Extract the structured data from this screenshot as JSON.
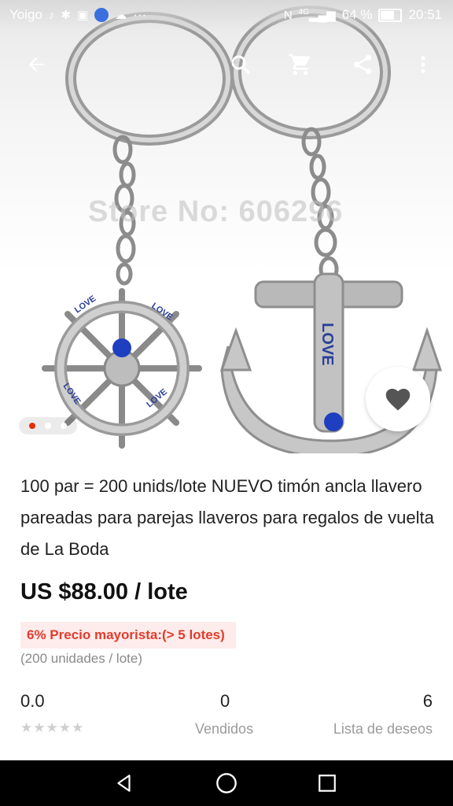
{
  "status_bar": {
    "carrier": "Yoigo",
    "battery": "64 %",
    "time": "20:51",
    "overflow": "···",
    "signal": "4G"
  },
  "icons": {
    "back": "arrow-left-icon",
    "search": "search-icon",
    "cart": "cart-icon",
    "share": "share-icon",
    "more": "more-vert-icon",
    "wishlist": "heart-icon"
  },
  "hero": {
    "watermark": "Store No: 606296",
    "carousel": {
      "count": 3,
      "active": 1
    },
    "love_text": "LOVE"
  },
  "product": {
    "title": "100 par = 200 unids/lote NUEVO timón ancla llavero pareadas para parejas llaveros para regalos de vuelta de La Boda",
    "price": "US $88.00 / lote",
    "wholesale": "6% Precio mayorista:(> 5 lotes)",
    "units": "(200 unidades / lote)"
  },
  "stats": {
    "rating": "0.0",
    "rating_stars": "★★★★★",
    "sold_value": "0",
    "sold_label": "Vendidos",
    "wishlist_value": "6",
    "wishlist_label": "Lista de deseos"
  },
  "colors": {
    "accent": "#e62e04",
    "wholesale_bg": "#fdeceb",
    "wholesale_text": "#e23c2c",
    "heart": "#555555"
  }
}
